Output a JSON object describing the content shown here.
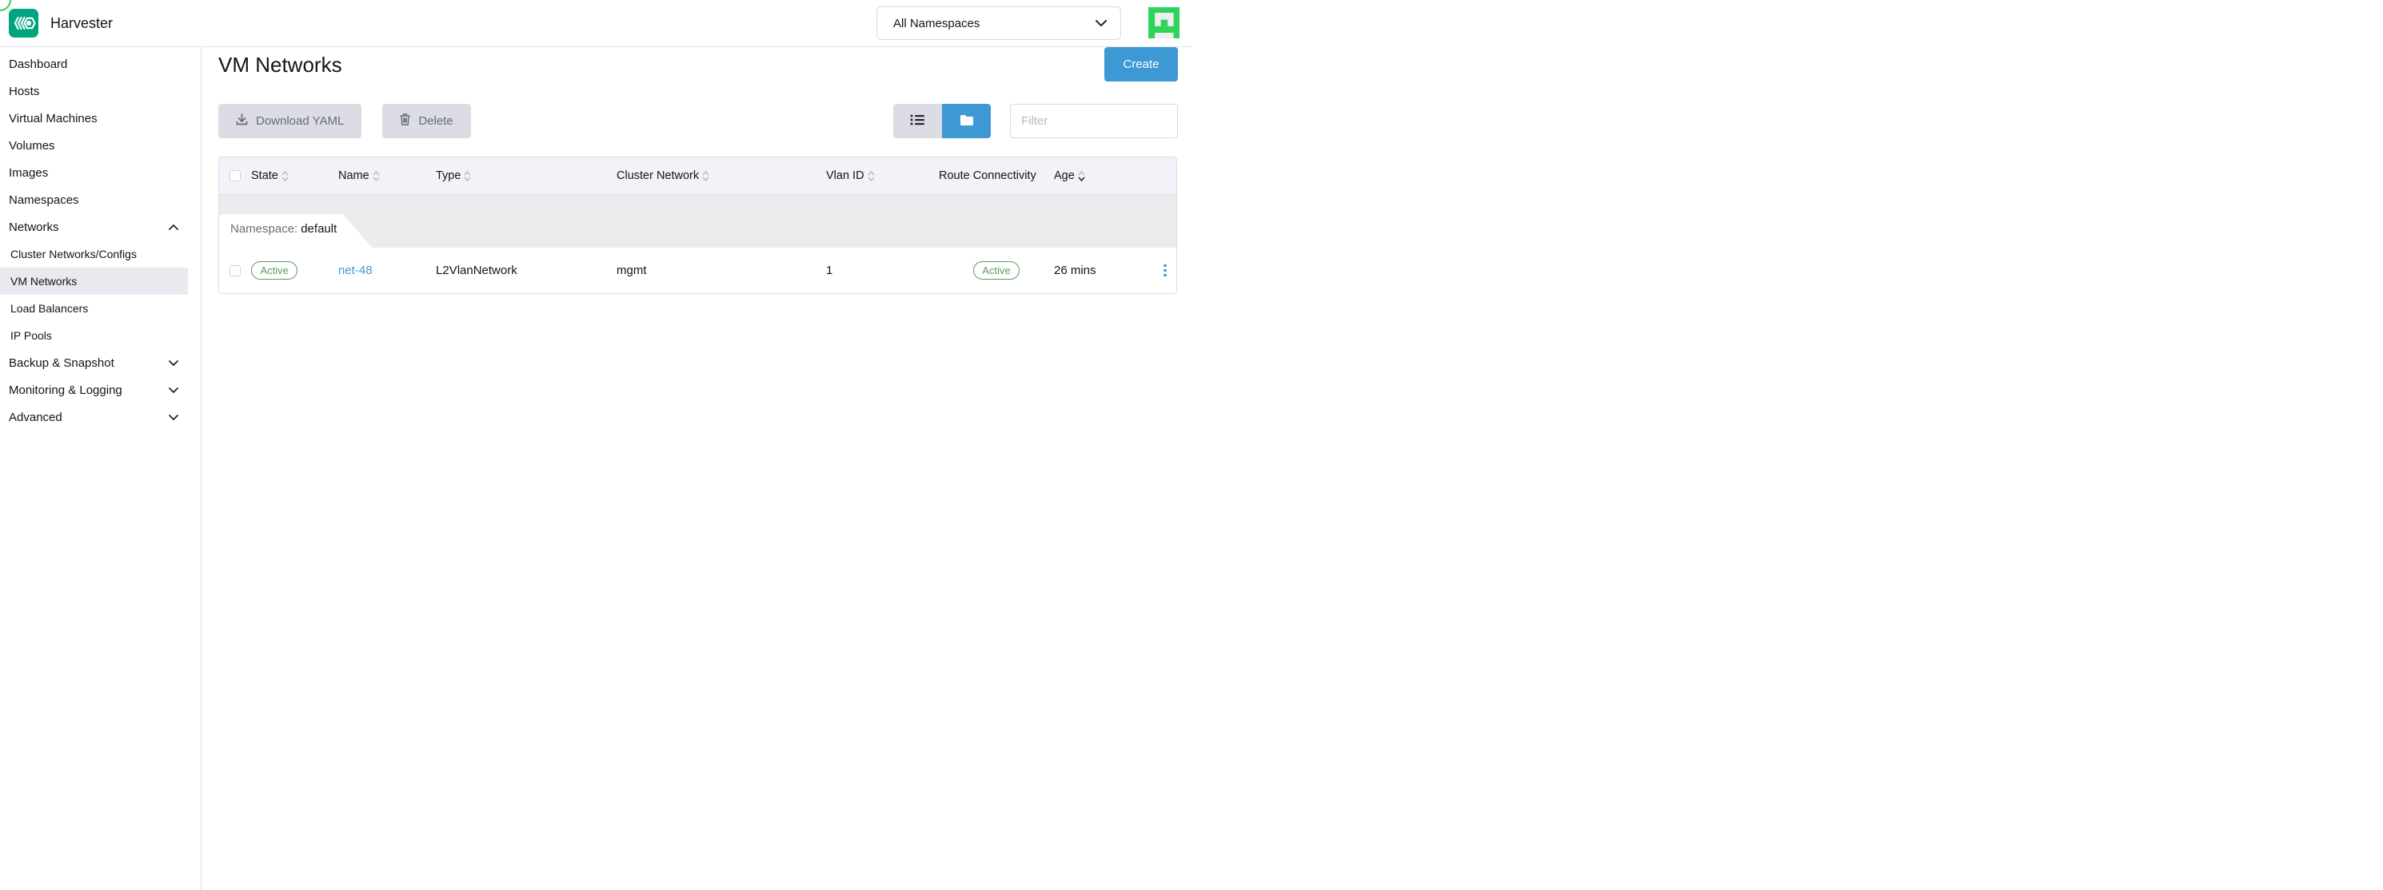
{
  "brand": {
    "app_name": "Harvester"
  },
  "header": {
    "namespace_selector": "All Namespaces"
  },
  "sidebar": {
    "items": [
      {
        "label": "Dashboard"
      },
      {
        "label": "Hosts"
      },
      {
        "label": "Virtual Machines"
      },
      {
        "label": "Volumes"
      },
      {
        "label": "Images"
      },
      {
        "label": "Namespaces"
      },
      {
        "label": "Networks",
        "expanded": true
      },
      {
        "label": "Cluster Networks/Configs",
        "child": true
      },
      {
        "label": "VM Networks",
        "child": true,
        "selected": true
      },
      {
        "label": "Load Balancers",
        "child": true
      },
      {
        "label": "IP Pools",
        "child": true
      },
      {
        "label": "Backup & Snapshot",
        "collapsed": true
      },
      {
        "label": "Monitoring & Logging",
        "collapsed": true
      },
      {
        "label": "Advanced",
        "collapsed": true
      }
    ]
  },
  "main": {
    "title": "VM Networks",
    "create_label": "Create",
    "toolbar": {
      "download_yaml_label": "Download YAML",
      "delete_label": "Delete",
      "filter_placeholder": "Filter"
    },
    "table": {
      "columns": [
        {
          "label": "State",
          "sortable": true
        },
        {
          "label": "Name",
          "sortable": true
        },
        {
          "label": "Type",
          "sortable": true
        },
        {
          "label": "Cluster Network",
          "sortable": true
        },
        {
          "label": "Vlan ID",
          "sortable": true
        },
        {
          "label": "Route Connectivity",
          "sortable": false
        },
        {
          "label": "Age",
          "sortable": true,
          "sort_active": "desc"
        }
      ],
      "group": {
        "label": "Namespace:",
        "value": "default"
      },
      "rows": [
        {
          "state": "Active",
          "name": "net-48",
          "type": "L2VlanNetwork",
          "cluster_network": "mgmt",
          "vlan_id": "1",
          "route_connectivity": "Active",
          "age": "26 mins"
        }
      ]
    }
  },
  "icons": [
    "harvester-logo-icon",
    "chevron-down-icon",
    "chevron-up-icon",
    "avatar-identicon",
    "download-icon",
    "trash-icon",
    "list-view-icon",
    "grouped-view-icon",
    "sort-arrows-icon",
    "kebab-menu-icon"
  ],
  "colors": {
    "primary_blue": "#3d98d3",
    "badge_green": "#5d9c5e",
    "brand_green": "#00a580",
    "avatar_green": "#2ed45a",
    "header_bg": "#f2f3f8",
    "group_bg": "#ececee"
  }
}
